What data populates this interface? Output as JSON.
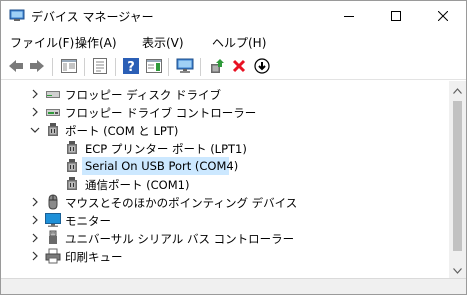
{
  "window": {
    "title": "デバイス マネージャー",
    "controls": {
      "minimize": "minimize-icon",
      "maximize": "maximize-icon",
      "close": "close-icon"
    }
  },
  "menu": [
    {
      "label": "ファイル(F)"
    },
    {
      "label": "操作(A)"
    },
    {
      "label": "表示(V)"
    },
    {
      "label": "ヘルプ(H)"
    }
  ],
  "toolbar": {
    "buttons": [
      "back-icon",
      "forward-icon",
      "show-hide-console-tree-icon",
      "properties-icon",
      "help-icon",
      "action-pane-icon",
      "scan-hardware-icon",
      "update-driver-icon",
      "uninstall-device-icon",
      "disable-device-icon"
    ]
  },
  "tree": [
    {
      "label": "フロッピー ディスク ドライブ",
      "level": 1,
      "expander": "collapsed",
      "icon": "floppy-disk-icon"
    },
    {
      "label": "フロッピー ドライブ コントローラー",
      "level": 1,
      "expander": "collapsed",
      "icon": "floppy-controller-icon"
    },
    {
      "label": "ポート (COM と LPT)",
      "level": 1,
      "expander": "expanded",
      "icon": "port-icon"
    },
    {
      "label": "ECP プリンター ポート (LPT1)",
      "level": 2,
      "icon": "port-icon"
    },
    {
      "label": "Serial On USB Port (COM4)",
      "level": 2,
      "icon": "port-icon",
      "selected": true
    },
    {
      "label": "通信ポート (COM1)",
      "level": 2,
      "icon": "port-icon"
    },
    {
      "label": "マウスとそのほかのポインティング デバイス",
      "level": 1,
      "expander": "collapsed",
      "icon": "mouse-icon"
    },
    {
      "label": "モニター",
      "level": 1,
      "expander": "collapsed",
      "icon": "monitor-icon"
    },
    {
      "label": "ユニバーサル シリアル バス コントローラー",
      "level": 1,
      "expander": "collapsed",
      "icon": "usb-icon"
    },
    {
      "label": "印刷キュー",
      "level": 1,
      "expander": "collapsed",
      "icon": "printer-icon"
    }
  ],
  "colors": {
    "selection": "#cce8ff",
    "delete_red": "#e81123",
    "help_blue": "#2b5fb6",
    "monitor_blue": "#1e90d8"
  }
}
